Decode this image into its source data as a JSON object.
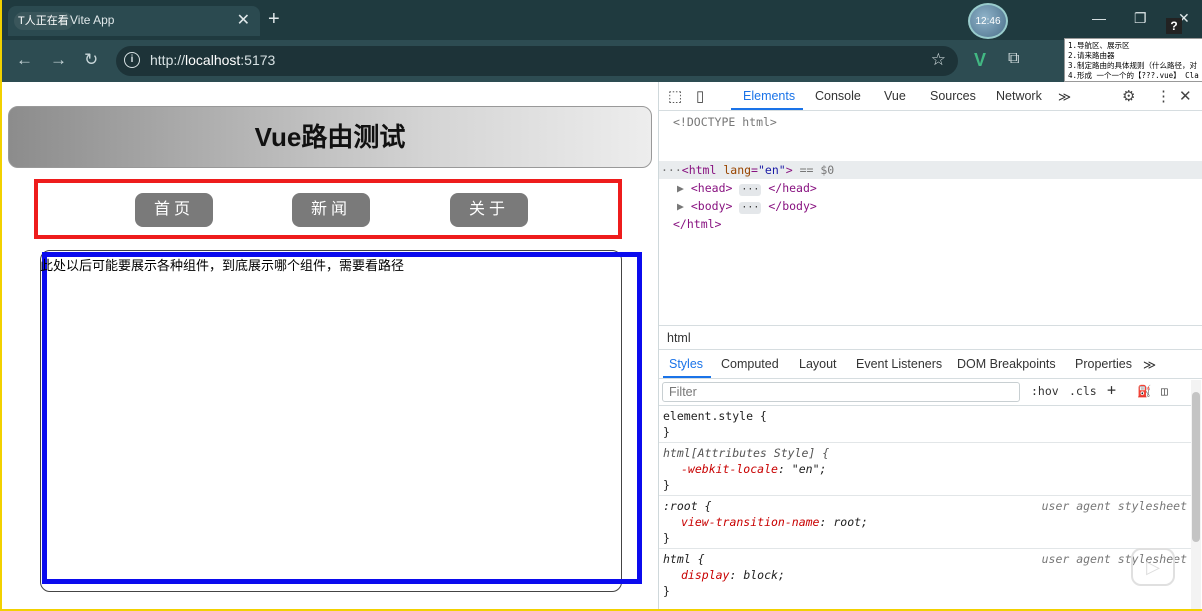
{
  "browser": {
    "tab_badge": "T人正在看",
    "tab_title": "Vite App",
    "tab_close": "✕",
    "new_tab": "+",
    "avatar_text": "12:46",
    "minimize": "—",
    "restore": "❐",
    "close": "✕",
    "url_scheme": "http://",
    "url_host": "localhost",
    "url_port": ":5173",
    "info_icon": "i",
    "star_icon": "☆",
    "ext_vue": "V",
    "ext_puzzle": "⧉",
    "help_icon": "?",
    "notes": [
      "1.导航区、展示区",
      "2.请来路由器",
      "3.制定路由的具体规则（什么路径，对",
      "4.形成 一个一个的【???.vue】 Cla"
    ]
  },
  "page": {
    "title": "Vue路由测试",
    "nav": [
      "首页",
      "新闻",
      "关于"
    ],
    "content_text": "此处以后可能要展示各种组件，到底展示哪个组件，需要看路径"
  },
  "devtools": {
    "tabs": [
      "Elements",
      "Console",
      "Vue",
      "Sources",
      "Network"
    ],
    "more_tabs": "≫",
    "dom": {
      "doctype": "<!DOCTYPE html>",
      "html_open_tag": "<html",
      "html_attr": "lang",
      "html_attr_val": "\"en\"",
      "html_close_bracket": ">",
      "html_eq": "== $0",
      "head_open": "<head>",
      "head_close": "</head>",
      "body_open": "<body>",
      "body_close": "</body>",
      "html_close": "</html>",
      "ellipsis": "···",
      "dots": "···"
    },
    "breadcrumb": "html",
    "style_tabs": [
      "Styles",
      "Computed",
      "Layout",
      "Event Listeners",
      "DOM Breakpoints",
      "Properties"
    ],
    "filter_placeholder": "Filter",
    "filter_tools": [
      ":hov",
      ".cls"
    ],
    "rules": [
      {
        "selector": "element.style {",
        "close": "}"
      },
      {
        "selector": "html[Attributes Style] {",
        "prop": "-webkit-locale",
        "val": "\"en\";",
        "close": "}"
      },
      {
        "selector": ":root {",
        "origin": "user agent stylesheet",
        "prop": "view-transition-name",
        "val": "root;",
        "close": "}"
      },
      {
        "selector": "html {",
        "origin": "user agent stylesheet",
        "prop": "display",
        "val": "block;",
        "close": "}"
      }
    ]
  }
}
